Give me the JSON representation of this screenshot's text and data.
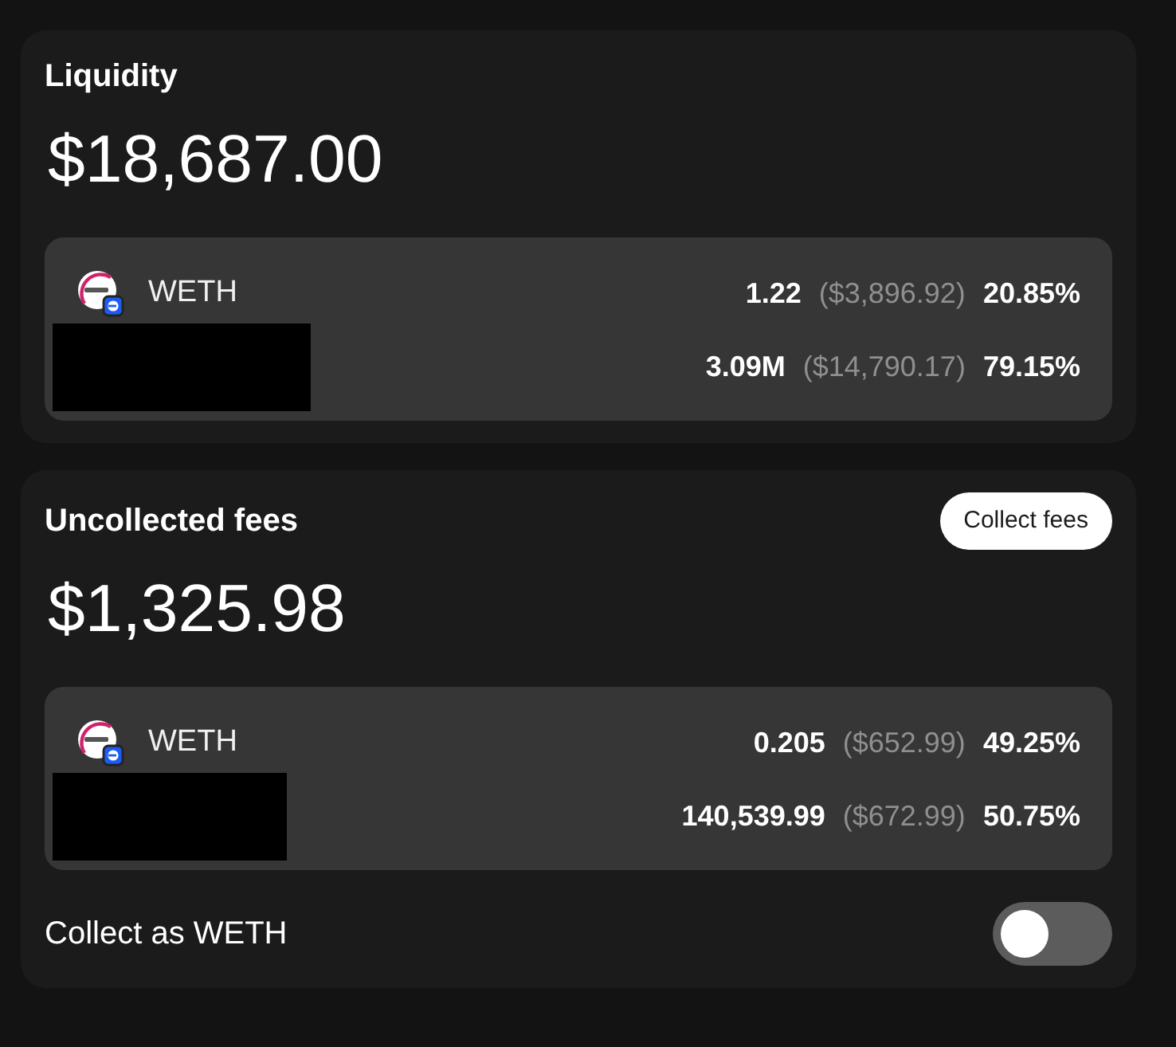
{
  "sections": [
    {
      "title": "Liquidity",
      "amount": "$18,687.00",
      "tokens": [
        {
          "kind": "named",
          "symbol": "WETH",
          "quantity": "1.22",
          "usd": "($3,896.92)",
          "share": "20.85%"
        },
        {
          "kind": "redacted",
          "quantity": "3.09M",
          "usd": "($14,790.17)",
          "share": "79.15%"
        }
      ]
    },
    {
      "title": "Uncollected fees",
      "action": "Collect fees",
      "amount": "$1,325.98",
      "tokens": [
        {
          "kind": "named",
          "symbol": "WETH",
          "quantity": "0.205",
          "usd": "($652.99)",
          "share": "49.25%"
        },
        {
          "kind": "redacted",
          "quantity": "140,539.99",
          "usd": "($672.99)",
          "share": "50.75%"
        }
      ],
      "toggle": {
        "label": "Collect as WETH",
        "on": false
      }
    }
  ]
}
